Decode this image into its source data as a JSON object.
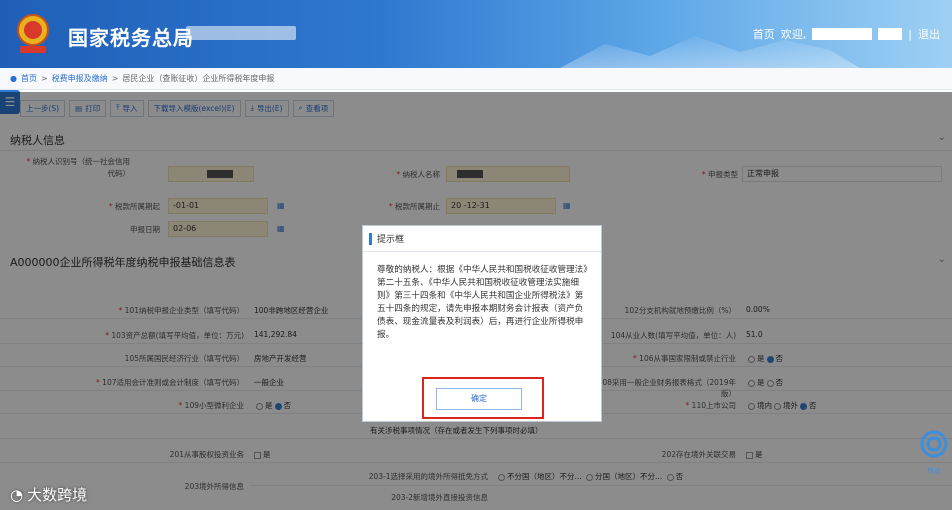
{
  "header": {
    "title": "国家税务总局",
    "home": "首页",
    "welcome": "欢迎,",
    "separator": "|",
    "logout": "退出"
  },
  "breadcrumb": {
    "home": "首页",
    "sep": ">",
    "level1": "税费申报及缴纳",
    "level2": "居民企业（查账征收）企业所得税年度申报"
  },
  "toolbar": {
    "prev": "上一步(S)",
    "print": "打印",
    "import": "导入",
    "download_template": "下载导入模版(excel)(E)",
    "export": "导出(E)",
    "query": "查看项"
  },
  "taxpayer": {
    "section_title": "纳税人信息",
    "id_label": "纳税人识别号（统一社会信用代码）",
    "name_label": "纳税人名称",
    "decl_type_label": "申报类型",
    "decl_type_value": "正常申报",
    "period_start_label": "税款所属期起",
    "period_start_value": "-01-01",
    "period_end_label": "税款所属期止",
    "period_end_value": "20  -12-31",
    "decl_date_label": "申报日期",
    "decl_date_value": "02-06"
  },
  "basic": {
    "section_title": "A000000企业所得税年度纳税申报基础信息表",
    "row101_label": "101纳税申报企业类型（填写代码）",
    "row101_value": "100非跨地区经营企业",
    "row102_label": "102分支机构就地预缴比例（%）",
    "row102_value": "0.00%",
    "row103_label": "103资产总额(填写平均值，单位：万元)",
    "row103_value": "141,292.84",
    "row104_label": "104从业人数(填写平均值，单位：人)",
    "row104_value": "51.0",
    "row105_label": "105所属国民经济行业（填写代码）",
    "row105_value": "房地产开发经营",
    "row106_label": "106从事国家限制或禁止行业",
    "row106_yes": "是",
    "row106_no": "否",
    "row107_label": "107适用会计准则或会计制度（填写代码）",
    "row107_value": "一般企业",
    "row108_label": "108采用一般企业财务报表格式（2019年版）",
    "row108_yes": "是",
    "row108_no": "否",
    "row109_label": "109小型微利企业",
    "row109_yes": "是",
    "row109_no": "否",
    "row110_label": "110上市公司",
    "row110_a": "境内",
    "row110_b": "境外",
    "row110_c": "否",
    "matters_title": "有关涉税事项情况（存在或者发生下列事项时必填）",
    "row201_label": "201从事股权投资业务",
    "row201_opt": "是",
    "row202_label": "202存在境外关联交易",
    "row202_opt": "是",
    "row203_label": "203境外所得信息",
    "row203_1_label": "203-1选择采用的境外所得抵免方式",
    "row203_1_a": "不分国（地区）不分...",
    "row203_1_b": "分国（地区）不分...",
    "row203_1_c": "否",
    "row203_2_label": "203-2新增境外直接投资信息"
  },
  "modal": {
    "title": "提示框",
    "body": "尊敬的纳税人：根据《中华人民共和国税收征收管理法》第二十五条、《中华人民共和国税收征收管理法实施细则》第三十四条和《中华人民共和国企业所得税法》第五十四条的规定，请先申报本期财务会计报表（资产负债表、现金流量表及利润表）后，再进行企业所得税申报。",
    "confirm": "确定"
  },
  "watermark": {
    "text": "大数跨境"
  },
  "help": {
    "label": "热点"
  },
  "colors": {
    "header_blue": "#2f78d0",
    "link_blue": "#2a6fd1",
    "highlight_red": "#dd2222"
  }
}
